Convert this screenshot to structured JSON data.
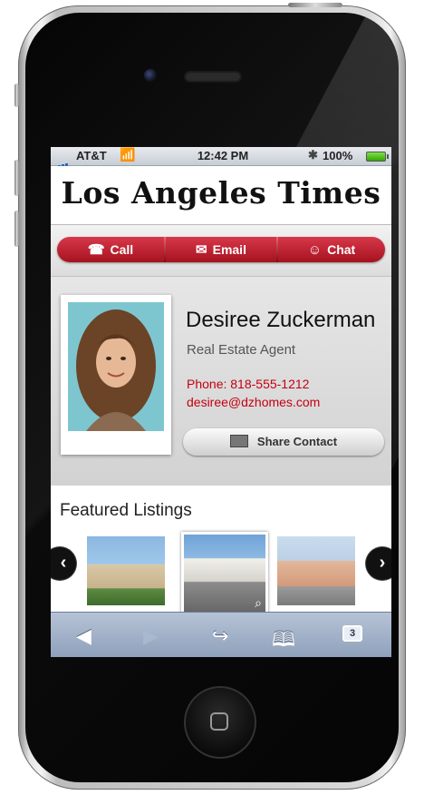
{
  "status_bar": {
    "carrier": "AT&T",
    "time": "12:42 PM",
    "battery": "100%"
  },
  "header": {
    "logo_text": "Los Angeles Times"
  },
  "actions": {
    "call": "Call",
    "email": "Email",
    "chat": "Chat"
  },
  "agent": {
    "name": "Desiree Zuckerman",
    "title": "Real Estate Agent",
    "phone": "Phone:  818-555-1212",
    "email": "desiree@dzhomes.com",
    "share_label": "Share Contact"
  },
  "featured": {
    "title": "Featured Listings"
  },
  "browser_toolbar": {
    "tab_count": "3"
  },
  "colors": {
    "accent_red": "#b81422",
    "toolbar_blue": "#9aaac2"
  }
}
